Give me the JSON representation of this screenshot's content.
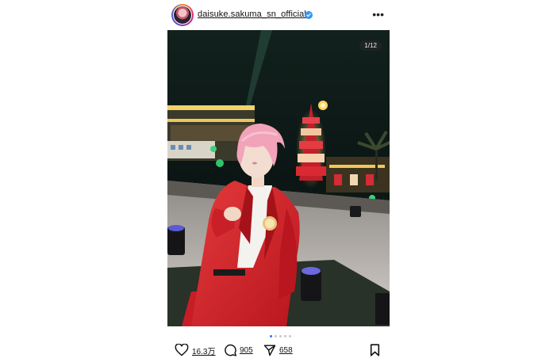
{
  "header": {
    "username": "daisuke.sakuma_sn_official",
    "verified": true,
    "more_icon": "more-horizontal-icon"
  },
  "media": {
    "counter": "1/12",
    "carousel_total": 5,
    "carousel_active": 1
  },
  "actions": {
    "likes": "16.3万",
    "comments": "905",
    "shares": "658"
  },
  "colors": {
    "verified": "#3797f0",
    "carousel_active": "#3d6cf0",
    "jacket": "#d8282e"
  }
}
